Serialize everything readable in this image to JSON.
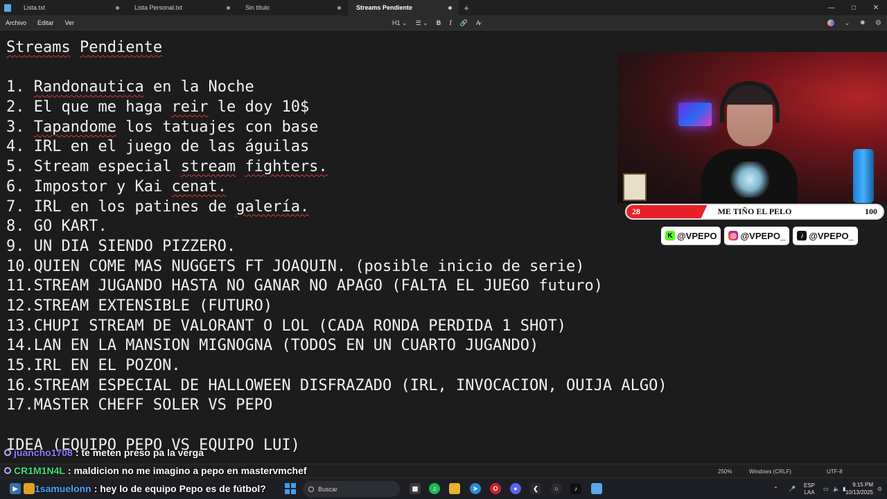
{
  "tabs": [
    {
      "label": "Lista.txt"
    },
    {
      "label": "Lista Personal.txt"
    },
    {
      "label": "Sin título"
    },
    {
      "label": "Streams Pendiente"
    }
  ],
  "menu": {
    "file": "Archivo",
    "edit": "Editar",
    "view": "Ver"
  },
  "format": {
    "heading": "H1",
    "chevron": "⌄",
    "list": "☰",
    "bold": "B",
    "italic": "I",
    "link": "🔗",
    "clear": "A̷"
  },
  "document": {
    "lines": [
      "Streams Pendiente",
      "",
      "1. Randonautica en la Noche",
      "2. El que me haga reir le doy 10$",
      "3. Tapandome los tatuajes con base",
      "4. IRL en el juego de las águilas",
      "5. Stream especial stream fighters.",
      "6. Impostor y Kai cenat.",
      "7. IRL en los patines de galería.",
      "8. GO KART.",
      "9. UN DIA SIENDO PIZZERO.",
      "10.QUIEN COME MAS NUGGETS FT JOAQUIN. (posible inicio de serie)",
      "11.STREAM JUGANDO HASTA NO GANAR NO APAGO (FALTA EL JUEGO futuro)",
      "12.STREAM EXTENSIBLE (FUTURO)",
      "13.CHUPI STREAM DE VALORANT O LOL (CADA RONDA PERDIDA 1 SHOT)",
      "14.LAN EN LA MANSION MIGNOGNA (TODOS EN UN CUARTO JUGANDO)",
      "15.IRL EN EL POZON.",
      "16.STREAM ESPECIAL DE HALLOWEEN DISFRAZADO (IRL, INVOCACION, OUIJA ALGO)",
      "17.MASTER CHEFF SOLER VS PEPO",
      "",
      "IDEA (EQUIPO PEPO VS EQUIPO LUI)"
    ]
  },
  "goal": {
    "current": "28",
    "title": "ME TIÑO EL PELO",
    "target": "100",
    "progress": 0.28,
    "color": "#e8202a"
  },
  "socials": [
    {
      "icon": "kick-icon",
      "glyph": "K",
      "handle": "@VPEPO"
    },
    {
      "icon": "instagram-icon",
      "glyph": "◎",
      "handle": "@VPEPO_"
    },
    {
      "icon": "tiktok-icon",
      "glyph": "♪",
      "handle": "@VPEPO_"
    }
  ],
  "chat": [
    {
      "user": "juancho1708",
      "color": "#8a7cff",
      "message": ": te meten preso pa la verga"
    },
    {
      "user": "CR1M1N4L",
      "color": "#3fe07a",
      "message": ": maldicion no me imagino a pepo en mastervmchef"
    },
    {
      "user": "1samuelonn",
      "color": "#4aa3ff",
      "message": ": hey lo de equipo Pepo es de fútbol?"
    }
  ],
  "status": {
    "zoom": "250%",
    "line_ending": "Windows (CRLF)",
    "encoding": "UTF-8"
  },
  "taskbar": {
    "search_placeholder": "Buscar",
    "lang_top": "ESP",
    "lang_bottom": "LAA",
    "time": "9:15 PM",
    "date": "10/13/2025"
  }
}
